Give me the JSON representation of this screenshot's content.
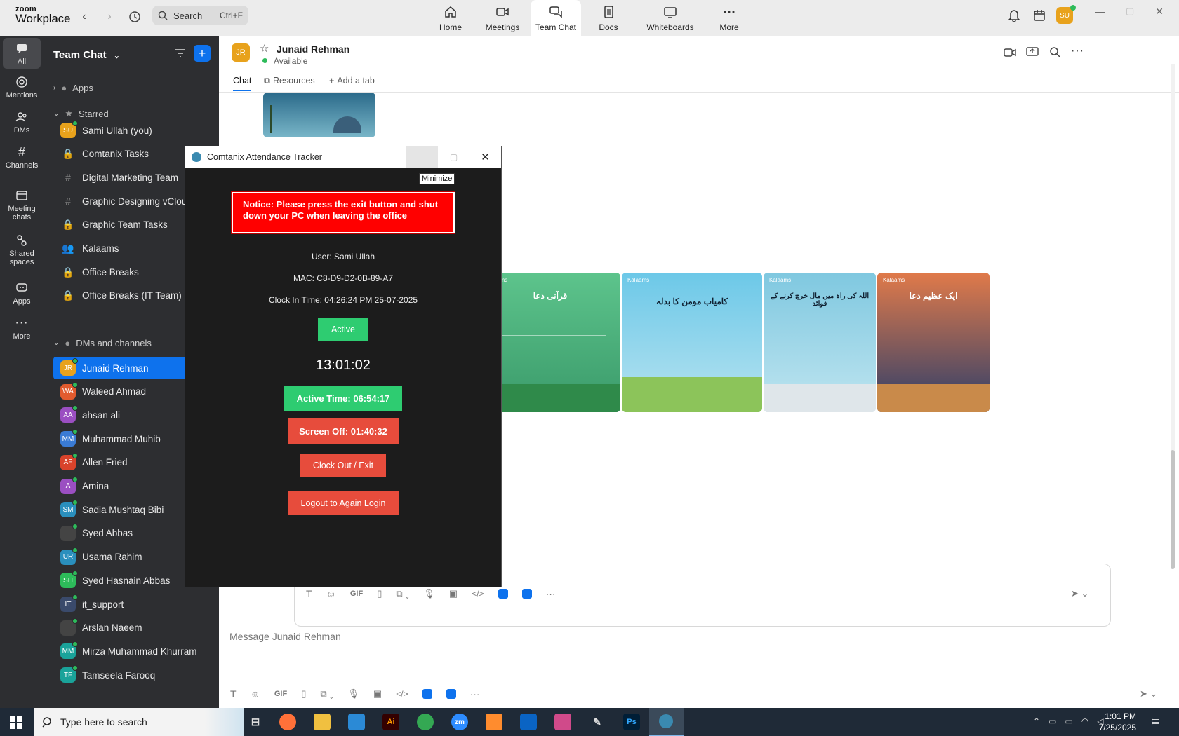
{
  "topbar": {
    "logo_line1": "zoom",
    "logo_line2": "Workplace",
    "search_placeholder": "Search",
    "search_shortcut": "Ctrl+F",
    "tabs": [
      {
        "label": "Home",
        "icon": "home-icon"
      },
      {
        "label": "Meetings",
        "icon": "video-icon"
      },
      {
        "label": "Team Chat",
        "icon": "chat-icon"
      },
      {
        "label": "Docs",
        "icon": "doc-icon"
      },
      {
        "label": "Whiteboards",
        "icon": "whiteboard-icon"
      },
      {
        "label": "More",
        "icon": "more-icon"
      }
    ],
    "avatar": "SU"
  },
  "rail": [
    {
      "label": "All"
    },
    {
      "label": "Mentions"
    },
    {
      "label": "DMs"
    },
    {
      "label": "Channels"
    },
    {
      "label": "Meeting chats"
    },
    {
      "label": "Shared spaces"
    },
    {
      "label": "Apps"
    },
    {
      "label": "More"
    }
  ],
  "sidebar": {
    "title": "Team Chat",
    "sec_apps": "Apps",
    "sec_starred": "Starred",
    "sec_dms": "DMs and channels",
    "starred": [
      {
        "label": "Sami Ullah (you)",
        "initials": "SU",
        "color": "#e8a21c"
      },
      {
        "label": "Comtanix Tasks",
        "type": "lock"
      },
      {
        "label": "Digital Marketing Team",
        "type": "hash"
      },
      {
        "label": "Graphic Designing vCloud",
        "type": "hash"
      },
      {
        "label": "Graphic Team Tasks",
        "type": "lock"
      },
      {
        "label": "Kalaams",
        "type": "group"
      },
      {
        "label": "Office Breaks",
        "type": "lock"
      },
      {
        "label": "Office Breaks (IT Team)",
        "type": "lock"
      }
    ],
    "dms": [
      {
        "label": "Junaid Rehman",
        "initials": "JR",
        "color": "#e8a21c",
        "selected": true
      },
      {
        "label": "Waleed Ahmad",
        "initials": "WA",
        "color": "#e25b2e"
      },
      {
        "label": "ahsan ali",
        "initials": "AA",
        "color": "#9b4fc2"
      },
      {
        "label": "Muhammad Muhib",
        "initials": "MM",
        "color": "#3a7bd5"
      },
      {
        "label": "Allen Fried",
        "initials": "AF",
        "color": "#d9432b"
      },
      {
        "label": "Amina",
        "initials": "A",
        "color": "#9b4fc2"
      },
      {
        "label": "Sadia Mushtaq Bibi",
        "initials": "SM",
        "color": "#2a8fbd"
      },
      {
        "label": "Syed Abbas",
        "initials": "",
        "color": "#444"
      },
      {
        "label": "Usama Rahim",
        "initials": "UR",
        "color": "#2a8fbd"
      },
      {
        "label": "Syed Hasnain Abbas",
        "initials": "SH",
        "color": "#2dbb5a"
      },
      {
        "label": "it_support",
        "initials": "IT",
        "color": "#3a4a6b"
      },
      {
        "label": "Arslan Naeem",
        "initials": "",
        "color": "#444"
      },
      {
        "label": "Mirza Muhammad Khurram",
        "initials": "MM",
        "color": "#1aa39a"
      },
      {
        "label": "Tamseela Farooq",
        "initials": "TF",
        "color": "#1aa39a"
      }
    ]
  },
  "chat": {
    "contact_initials": "JR",
    "contact_name": "Junaid Rehman",
    "status": "Available",
    "tabs": [
      "Chat",
      "Resources",
      "Add a tab"
    ],
    "message_placeholder": "Message Junaid Rehman",
    "toolbar_gif": "GIF",
    "images": [
      {
        "title": "قرآنی دعا",
        "bg": "#5dc48c"
      },
      {
        "title": "کامیاب مومن کا بدلہ",
        "bg": "#6cc8e8"
      },
      {
        "title": "اللہ کی راہ میں مال خرچ کرنے کے فوائد",
        "bg": "#7fc8e0"
      },
      {
        "title": "ایک عظیم دعا",
        "bg": "#e07a4a"
      }
    ],
    "brand": "Kalaams"
  },
  "tracker": {
    "title": "Comtanix Attendance Tracker",
    "tooltip": "Minimize",
    "notice": "Notice: Please press the exit button and shut down your PC when leaving the office",
    "user": "User: Sami Ullah",
    "mac": "MAC: C8-D9-D2-0B-89-A7",
    "clock_in": "Clock In Time: 04:26:24 PM 25-07-2025",
    "status": "Active",
    "clock": "13:01:02",
    "active_time": "Active Time: 06:54:17",
    "screen_off": "Screen Off: 01:40:32",
    "clock_out": "Clock Out / Exit",
    "logout": "Logout to Again Login"
  },
  "taskbar": {
    "search_placeholder": "Type here to search",
    "time": "1:01 PM",
    "date": "7/25/2025"
  }
}
